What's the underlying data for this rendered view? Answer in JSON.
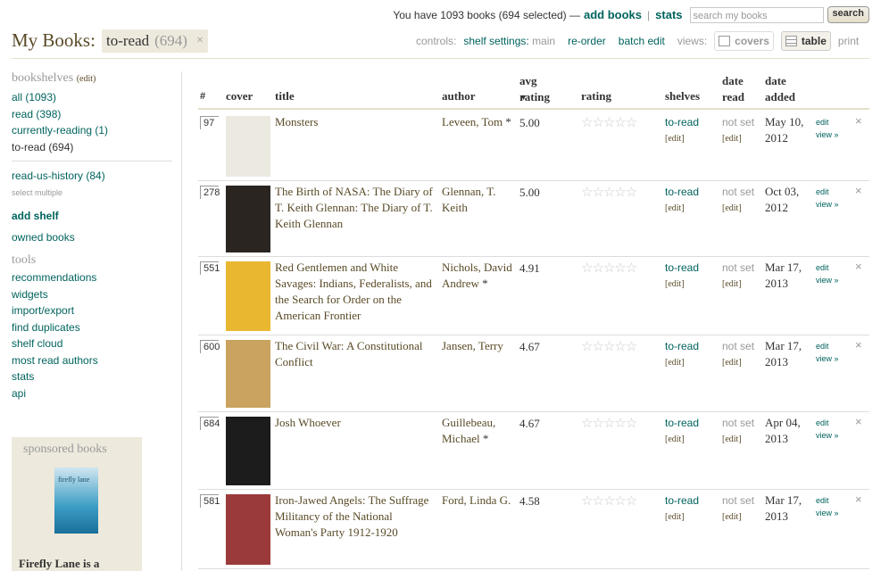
{
  "header": {
    "summary": "You have 1093 books (694 selected) —",
    "add_books": "add books",
    "stats": "stats",
    "search_placeholder": "search my books",
    "search_button": "search",
    "title": "My Books:",
    "shelf_name": "to-read",
    "shelf_count": "(694)",
    "remove": "×"
  },
  "controls": {
    "label": "controls:",
    "shelf_settings": "shelf settings:",
    "shelf_settings_value": "main",
    "reorder": "re-order",
    "batch_edit": "batch edit",
    "views_label": "views:",
    "covers": "covers",
    "table": "table",
    "print": "print"
  },
  "sidebar": {
    "bookshelves_title": "bookshelves",
    "bookshelves_edit": "(edit)",
    "shelves": [
      "all (1093)",
      "read (398)",
      "currently-reading (1)",
      "to-read (694)"
    ],
    "custom_shelves": [
      "read-us-history (84)"
    ],
    "select_multiple": "select multiple",
    "add_shelf": "add shelf",
    "owned_books": "owned books",
    "tools_title": "tools",
    "tools": [
      "recommendations",
      "widgets",
      "import/export",
      "find duplicates",
      "shelf cloud",
      "most read authors",
      "stats",
      "api"
    ],
    "sponsored_title": "sponsored books",
    "sponsored_cover_text": "firefly lane",
    "sponsored_book_title": "Firefly Lane is a"
  },
  "table": {
    "columns": {
      "num": "#",
      "cover": "cover",
      "title": "title",
      "author": "author",
      "avg_rating_1": "avg",
      "avg_rating_2": "rating",
      "rating": "rating",
      "shelves": "shelves",
      "date_read_1": "date",
      "date_read_2": "read",
      "date_added_1": "date",
      "date_added_2": "added"
    },
    "rows": [
      {
        "num": "97",
        "title": "Monsters",
        "author": "Leveen, Tom",
        "author_star": "*",
        "avg": "5.00",
        "stars": "☆☆☆☆☆",
        "shelf": "to-read",
        "shelf_edit": "[edit]",
        "date_read": "not set",
        "date_read_edit": "[edit]",
        "date_added": "May 10, 2012",
        "edit": "edit",
        "view": "view »",
        "del": "×",
        "cover_color": "#ece9e0"
      },
      {
        "num": "278",
        "title": "The Birth of NASA: The Diary of T. Keith Glennan: The Diary of T. Keith Glennan",
        "author": "Glennan, T. Keith",
        "author_star": "",
        "avg": "5.00",
        "stars": "☆☆☆☆☆",
        "shelf": "to-read",
        "shelf_edit": "[edit]",
        "date_read": "not set",
        "date_read_edit": "[edit]",
        "date_added": "Oct 03, 2012",
        "edit": "edit",
        "view": "view »",
        "del": "×",
        "cover_color": "#2b2521"
      },
      {
        "num": "551",
        "title": "Red Gentlemen and White Savages: Indians, Federalists, and the Search for Order on the American Frontier",
        "author": "Nichols, David Andrew",
        "author_star": "*",
        "avg": "4.91",
        "stars": "☆☆☆☆☆",
        "shelf": "to-read",
        "shelf_edit": "[edit]",
        "date_read": "not set",
        "date_read_edit": "[edit]",
        "date_added": "Mar 17, 2013",
        "edit": "edit",
        "view": "view »",
        "del": "×",
        "cover_color": "#e9b830"
      },
      {
        "num": "600",
        "title": "The Civil War: A Constitutional Conflict",
        "author": "Jansen, Terry",
        "author_star": "",
        "avg": "4.67",
        "stars": "☆☆☆☆☆",
        "shelf": "to-read",
        "shelf_edit": "[edit]",
        "date_read": "not set",
        "date_read_edit": "[edit]",
        "date_added": "Mar 17, 2013",
        "edit": "edit",
        "view": "view »",
        "del": "×",
        "cover_color": "#c9a35f"
      },
      {
        "num": "684",
        "title": "Josh Whoever",
        "author": "Guillebeau, Michael",
        "author_star": "*",
        "avg": "4.67",
        "stars": "☆☆☆☆☆",
        "shelf": "to-read",
        "shelf_edit": "[edit]",
        "date_read": "not set",
        "date_read_edit": "[edit]",
        "date_added": "Apr 04, 2013",
        "edit": "edit",
        "view": "view »",
        "del": "×",
        "cover_color": "#1c1c1c"
      },
      {
        "num": "581",
        "title": "Iron-Jawed Angels: The Suffrage Militancy of the National Woman's Party 1912-1920",
        "author": "Ford, Linda G.",
        "author_star": "",
        "avg": "4.58",
        "stars": "☆☆☆☆☆",
        "shelf": "to-read",
        "shelf_edit": "[edit]",
        "date_read": "not set",
        "date_read_edit": "[edit]",
        "date_added": "Mar 17, 2013",
        "edit": "edit",
        "view": "view »",
        "del": "×",
        "cover_color": "#9b3a3a"
      }
    ]
  }
}
